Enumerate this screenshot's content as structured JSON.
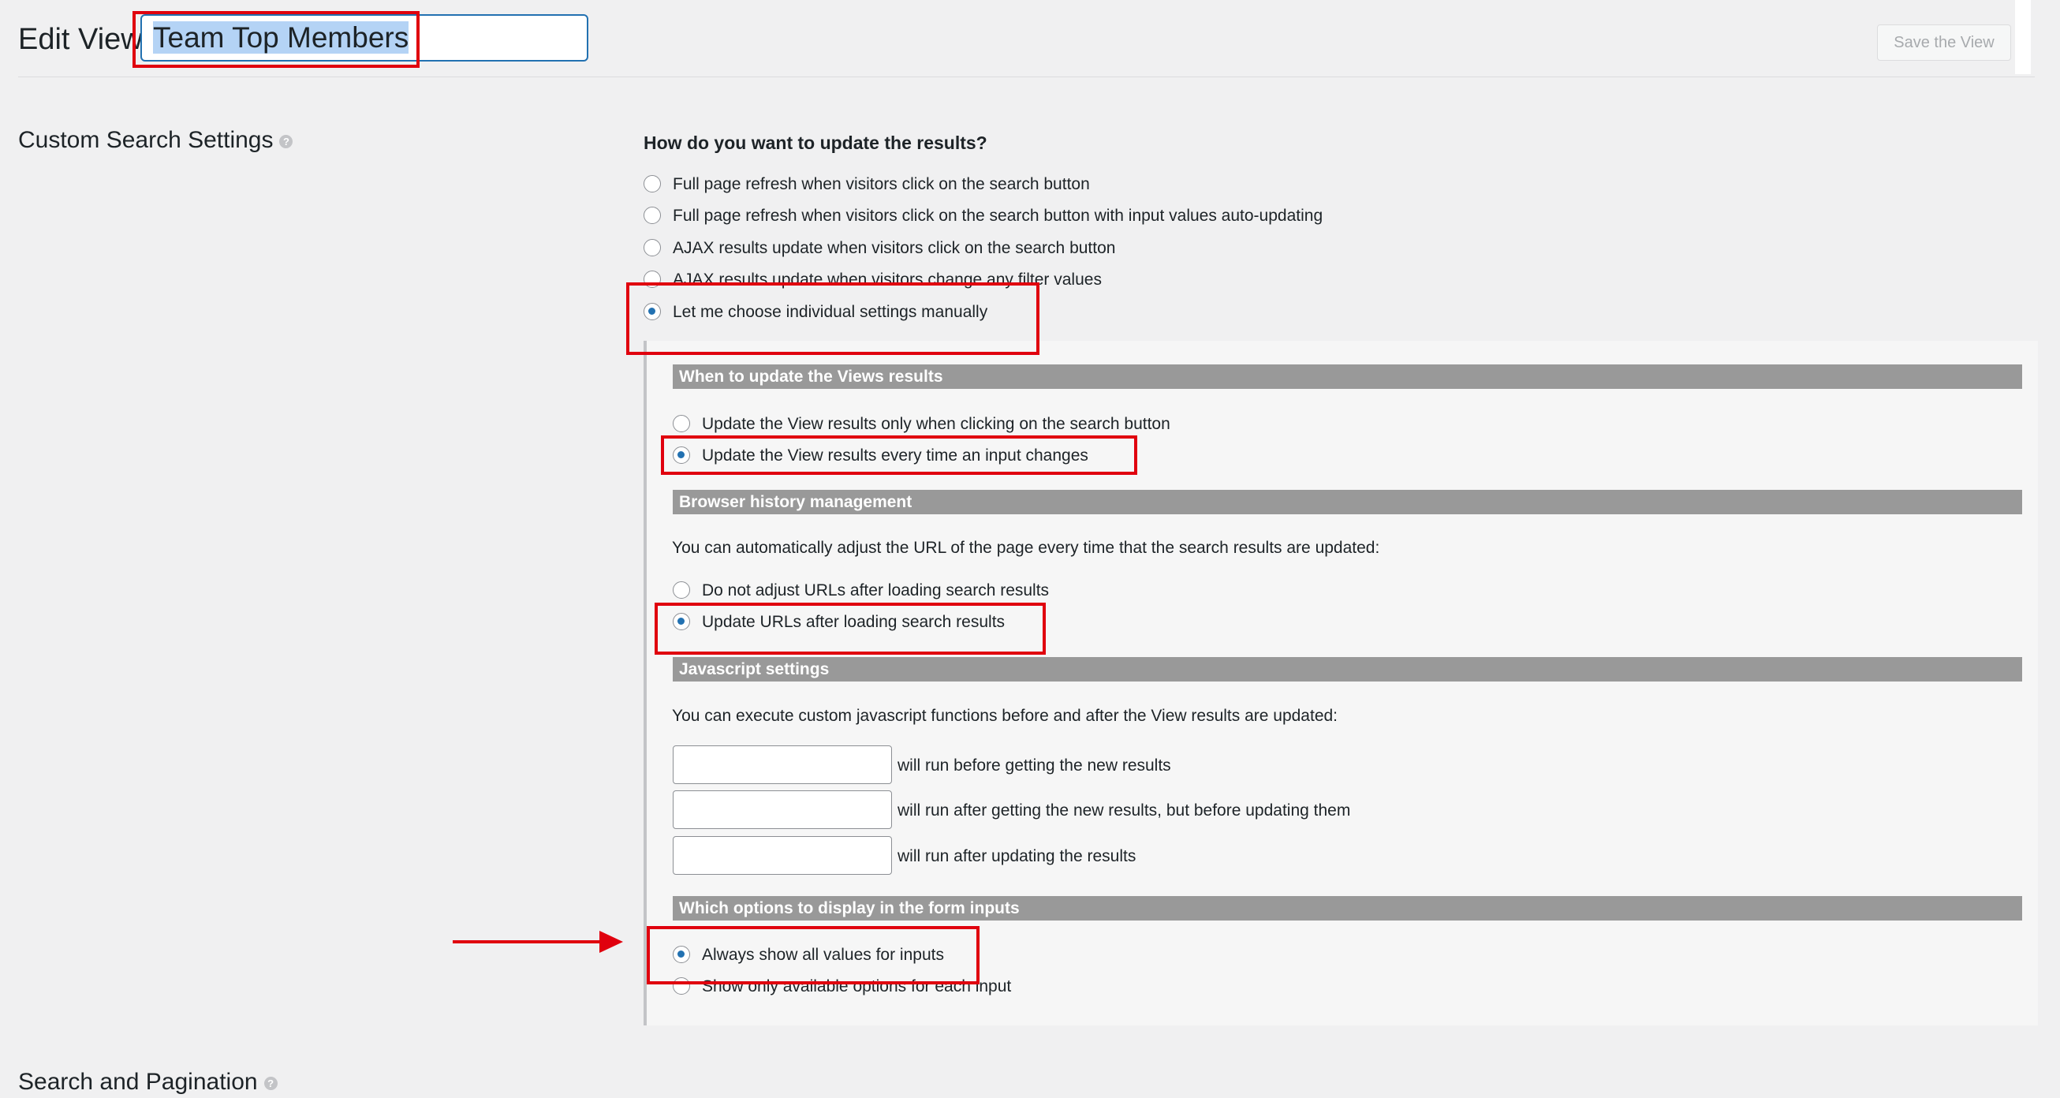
{
  "header": {
    "title": "Edit View",
    "view_name": "Team Top Members",
    "save_label": "Save the View"
  },
  "custom_search": {
    "title": "Custom Search Settings",
    "question": "How do you want to update the results?",
    "options": [
      {
        "label": "Full page refresh when visitors click on the search button",
        "selected": false
      },
      {
        "label": "Full page refresh when visitors click on the search button with input values auto-updating",
        "selected": false
      },
      {
        "label": "AJAX results update when visitors click on the search button",
        "selected": false
      },
      {
        "label": "AJAX results update when visitors change any filter values",
        "selected": false
      },
      {
        "label": "Let me choose individual settings manually",
        "selected": true
      }
    ],
    "when_update": {
      "title": "When to update the Views results",
      "options": [
        {
          "label": "Update the View results only when clicking on the search button",
          "selected": false
        },
        {
          "label": "Update the View results every time an input changes",
          "selected": true
        }
      ]
    },
    "browser_history": {
      "title": "Browser history management",
      "description": "You can automatically adjust the URL of the page every time that the search results are updated:",
      "options": [
        {
          "label": "Do not adjust URLs after loading search results",
          "selected": false
        },
        {
          "label": "Update URLs after loading search results",
          "selected": true
        }
      ]
    },
    "javascript": {
      "title": "Javascript settings",
      "description": "You can execute custom javascript functions before and after the View results are updated:",
      "fields": [
        {
          "value": "",
          "label": "will run before getting the new results"
        },
        {
          "value": "",
          "label": "will run after getting the new results, but before updating them"
        },
        {
          "value": "",
          "label": "will run after updating the results"
        }
      ]
    },
    "form_inputs": {
      "title": "Which options to display in the form inputs",
      "options": [
        {
          "label": "Always show all values for inputs",
          "selected": true
        },
        {
          "label": "Show only available options for each input",
          "selected": false
        }
      ]
    }
  },
  "search_pagination": {
    "title": "Search and Pagination"
  },
  "icons": {
    "help": "help-icon",
    "arrow": "red-arrow-annotation"
  },
  "colors": {
    "accent": "#2271b1",
    "annotation": "#e0000e",
    "section_bar": "#999999",
    "background": "#f0f0f1"
  }
}
